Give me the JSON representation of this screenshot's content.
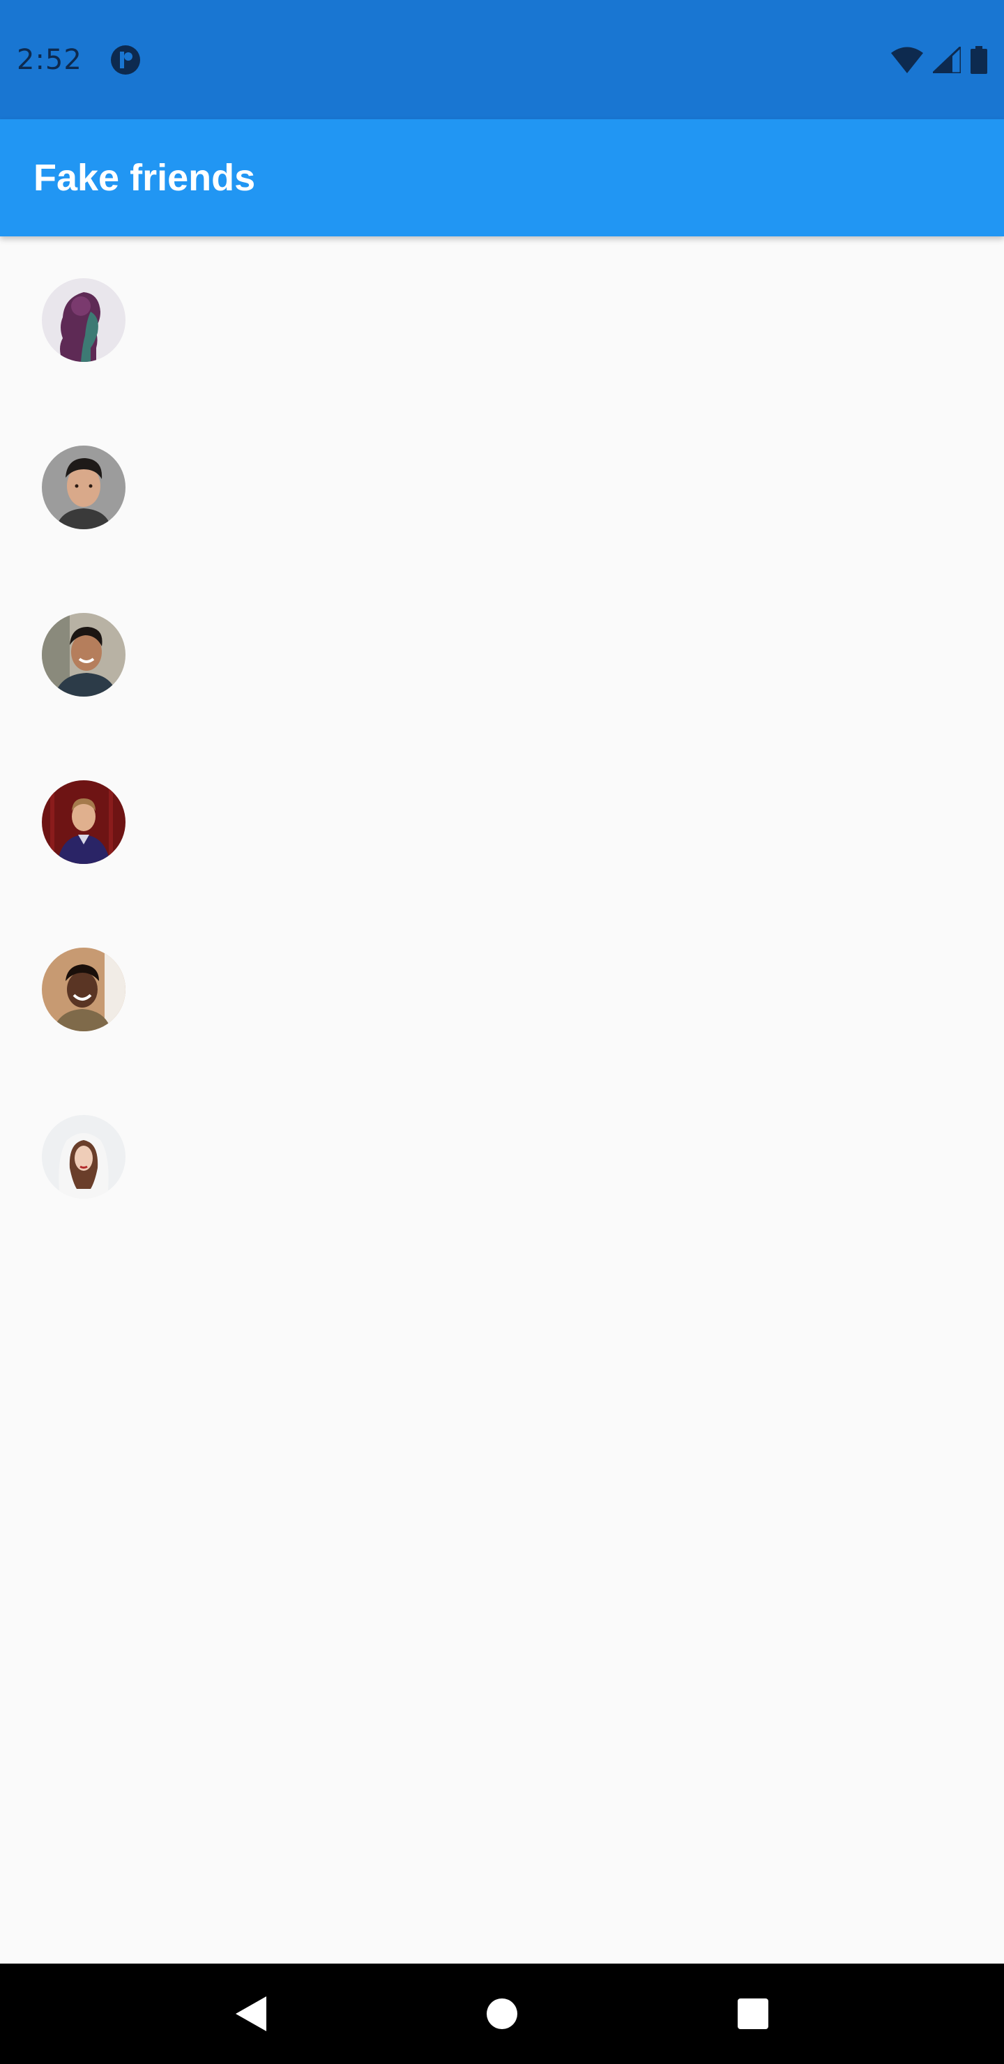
{
  "status_bar": {
    "time": "2:52",
    "icons": [
      "app-notification-icon",
      "wifi-icon",
      "cell-signal-icon",
      "battery-icon"
    ]
  },
  "app_bar": {
    "title": "Fake friends"
  },
  "friends": [
    {
      "avatar": "avatar-purple-profile"
    },
    {
      "avatar": "avatar-young-man"
    },
    {
      "avatar": "avatar-smiling-man"
    },
    {
      "avatar": "avatar-man-red-curtain"
    },
    {
      "avatar": "avatar-laughing-man"
    },
    {
      "avatar": "avatar-woman-white-hood"
    }
  ],
  "nav_bar": {
    "icons": [
      "back-icon",
      "home-icon",
      "recents-icon"
    ]
  },
  "colors": {
    "status_bar": "#1976d2",
    "app_bar": "#2196f3",
    "background": "#fafafa",
    "nav_bar": "#000000"
  }
}
